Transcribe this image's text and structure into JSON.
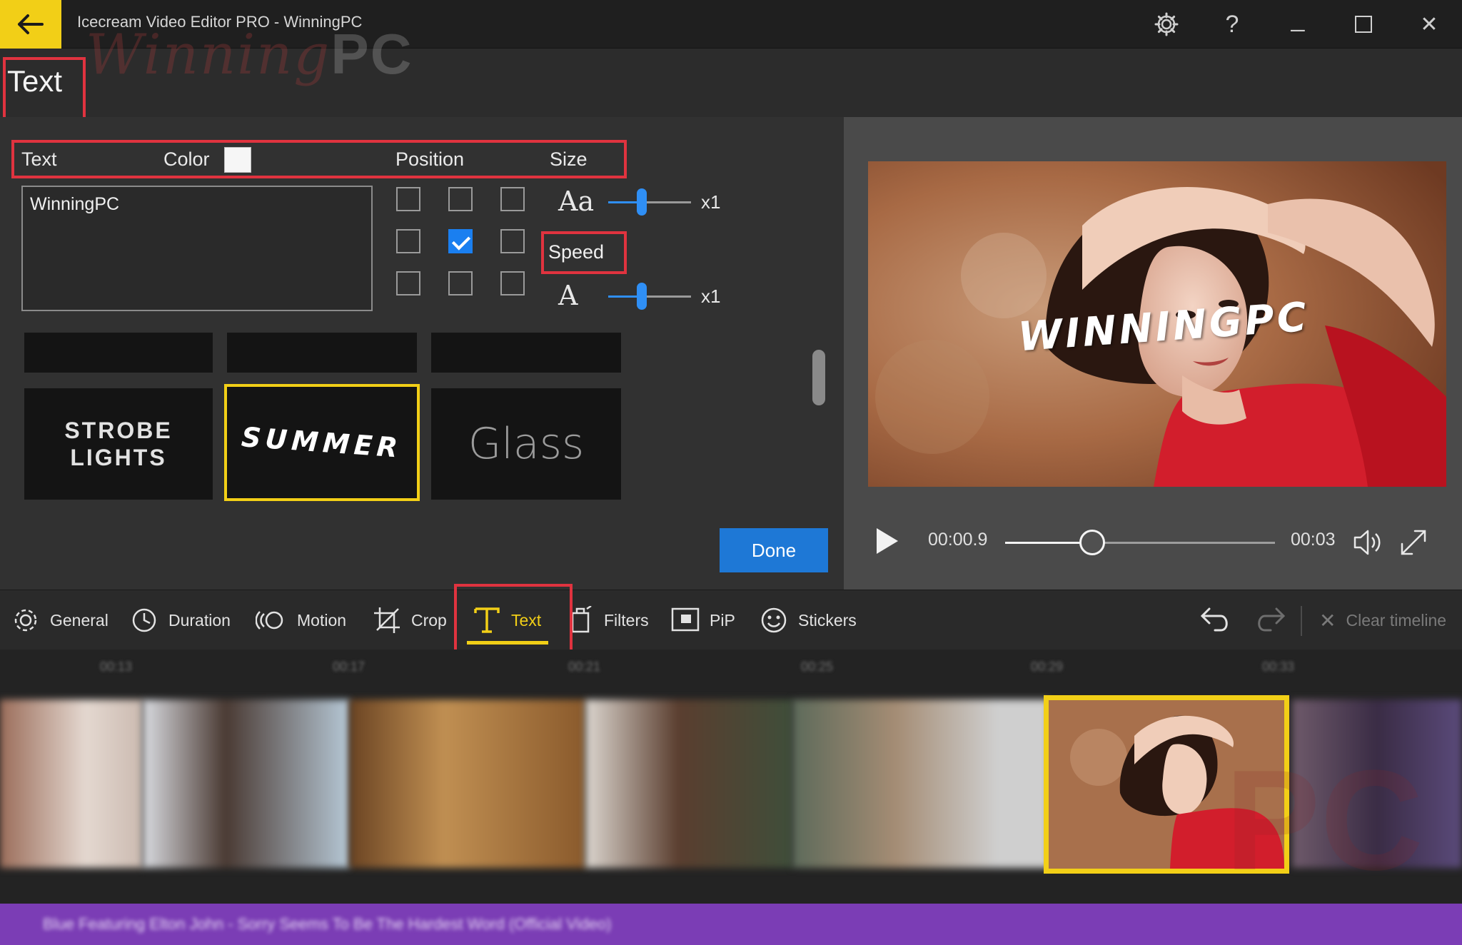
{
  "app": {
    "title": "Icecream Video Editor PRO -  WinningPC",
    "watermark_script": "Winning",
    "watermark_block": "PC"
  },
  "titlebar": {
    "icons": [
      "back-arrow-icon",
      "gear-icon",
      "help-icon",
      "minimize-icon",
      "maximize-icon",
      "close-icon"
    ],
    "help_glyph": "?",
    "minimize_glyph": "_",
    "close_glyph": "✕"
  },
  "section": {
    "title": "Text"
  },
  "editor": {
    "columns": {
      "text": "Text",
      "color": "Color",
      "position": "Position",
      "size": "Size"
    },
    "text_value": "WinningPC",
    "color_value": "#f6f6f6",
    "position_grid": [
      [
        false,
        false,
        false
      ],
      [
        false,
        true,
        false
      ],
      [
        false,
        false,
        false
      ]
    ],
    "size": {
      "glyph": "Aa",
      "value_label": "x1",
      "level": 0.4
    },
    "speed": {
      "label": "Speed",
      "glyph": "A",
      "value_label": "x1",
      "level": 0.4
    },
    "styles": [
      {
        "name": "STROBE\nLIGHTS",
        "line1": "STROBE",
        "line2": "LIGHTS",
        "selected": false
      },
      {
        "name": "SUMMER",
        "display": "SUMMER",
        "selected": true
      },
      {
        "name": "Glass",
        "display": "Glass",
        "selected": false
      }
    ],
    "done_label": "Done"
  },
  "preview": {
    "overlay_text": "WINNINGPC",
    "current_time": "00:00.9",
    "total_time": "00:03",
    "progress": 0.3
  },
  "toolbar": {
    "items": [
      {
        "label": "General",
        "icon": "gear-icon",
        "active": false
      },
      {
        "label": "Duration",
        "icon": "clock-icon",
        "active": false
      },
      {
        "label": "Motion",
        "icon": "motion-icon",
        "active": false
      },
      {
        "label": "Crop",
        "icon": "crop-icon",
        "active": false
      },
      {
        "label": "Text",
        "icon": "text-T-icon",
        "active": true
      },
      {
        "label": "Filters",
        "icon": "filters-icon",
        "active": false
      },
      {
        "label": "PiP",
        "icon": "pip-icon",
        "active": false
      },
      {
        "label": "Stickers",
        "icon": "sticker-smiley-icon",
        "active": false
      }
    ],
    "clear_timeline": "Clear timeline"
  },
  "colors": {
    "accent_yellow": "#f2cf17",
    "highlight_red": "#e0333f",
    "done_blue": "#1e78d6",
    "slider_blue": "#2f8ff5",
    "audio_purple": "#7b3db5"
  }
}
